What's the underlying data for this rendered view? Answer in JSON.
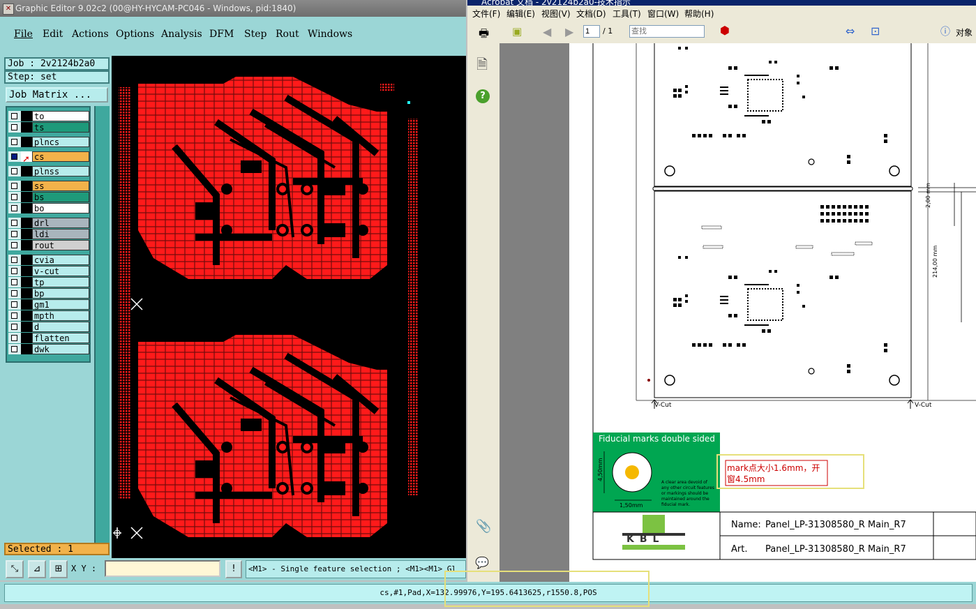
{
  "ge": {
    "title": "Graphic Editor 9.02c2 (00@HY-HYCAM-PC046 - Windows, pid:1840)",
    "menu": [
      "File",
      "Edit",
      "Actions",
      "Options",
      "Analysis",
      "DFM",
      "Step",
      "Rout",
      "Windows"
    ],
    "job_label": "Job : 2v2124b2a0",
    "step_label": "Step: set",
    "job_matrix": "Job Matrix ...",
    "layers": [
      {
        "name": "to",
        "color": "#ffffff"
      },
      {
        "name": "ts",
        "color": "#1e9a7a"
      },
      {
        "name": "plncs",
        "color": "#b7ecec"
      },
      {
        "name": "cs",
        "color": "#f2b24a"
      },
      {
        "name": "plnss",
        "color": "#b7ecec"
      },
      {
        "name": "ss",
        "color": "#f2b24a"
      },
      {
        "name": "bs",
        "color": "#1e9a7a"
      },
      {
        "name": "bo",
        "color": "#ffffff"
      },
      {
        "name": "drl",
        "color": "#a9b5bd"
      },
      {
        "name": "ldi",
        "color": "#a9b5bd"
      },
      {
        "name": "rout",
        "color": "#d0d0d0"
      },
      {
        "name": "cvia",
        "color": "#b7ecec"
      },
      {
        "name": "v-cut",
        "color": "#b7ecec"
      },
      {
        "name": "tp",
        "color": "#b7ecec"
      },
      {
        "name": "bp",
        "color": "#b7ecec"
      },
      {
        "name": "gm1",
        "color": "#b7ecec"
      },
      {
        "name": "mpth",
        "color": "#b7ecec"
      },
      {
        "name": "d",
        "color": "#b7ecec"
      },
      {
        "name": "flatten",
        "color": "#b7ecec"
      },
      {
        "name": "dwk",
        "color": "#b7ecec"
      }
    ],
    "selected_label": "Selected : 1",
    "xy_label": "X Y :",
    "xy_value": "",
    "hint": "<M1> - Single feature selection ; <M1><M1> Gl",
    "status": "cs,#1,Pad,X=132.99976,Y=195.6413625,r1550.8,POS"
  },
  "acrobat": {
    "title": "Acrobat 文档 - 2v2124b2a0-技术指示",
    "menu": [
      "文件(F)",
      "编辑(E)",
      "视图(V)",
      "文档(D)",
      "工具(T)",
      "窗口(W)",
      "帮助(H)"
    ],
    "page_current": "1",
    "page_total": "/ 1",
    "search_placeholder": "查找",
    "right_label": "对象",
    "vcut_left": "V-Cut",
    "vcut_right": "V-Cut",
    "dim_200": "2,00 mm",
    "dim_214": "214,00 mm",
    "fiducial_title": "Fiducial marks double sided",
    "fid_dim_v": "4,50mm",
    "fid_dim_h": "1,50mm",
    "fid_note": "A clear area devoid of any other circuit features or markings should be maintained around the fiducial mark.",
    "annotation": "mark点大小1.6mm，开窗4.5mm",
    "name_label": "Name:",
    "name_value": "Panel_LP-31308580_R Main_R7",
    "art_label": "Art.",
    "art_value": "Panel_LP-31308580_R Main_R7",
    "logo_text": "KBL"
  }
}
